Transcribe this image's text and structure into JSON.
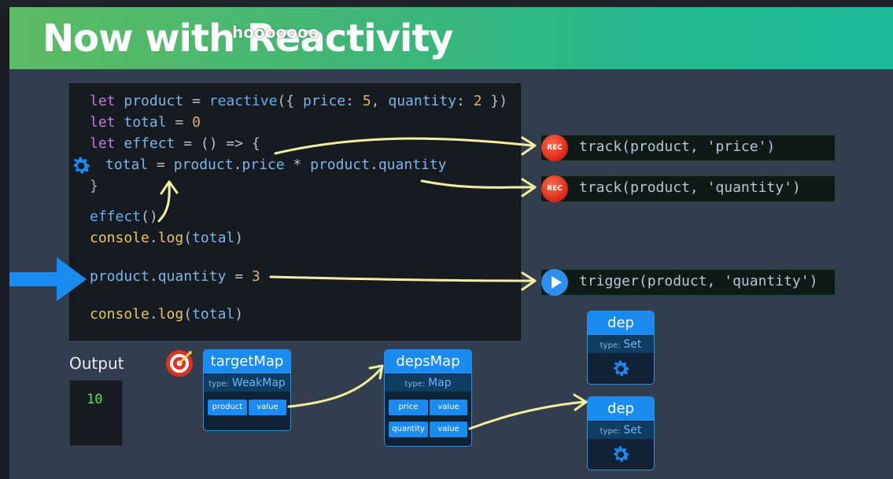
{
  "slide": {
    "title": "Now with Reactivity",
    "watermark": "hooooooo"
  },
  "code": {
    "l1": {
      "kw": "let",
      "name": "product",
      "eq": " = ",
      "fn": "reactive",
      "rest1": "({ ",
      "k1": "price",
      "c1": ": ",
      "v1": "5",
      "sep": ", ",
      "k2": "quantity",
      "c2": ": ",
      "v2": "2",
      "rest2": " })"
    },
    "l2": {
      "kw": "let",
      "name": "total",
      "eq": " = ",
      "v": "0"
    },
    "l3": {
      "kw": "let",
      "name": "effect",
      "rest": " = () => {"
    },
    "l4": {
      "a": "total",
      "eq": " = ",
      "b": "product",
      "dot1": ".",
      "c": "price",
      "mul": " * ",
      "d": "product",
      "dot2": ".",
      "e": "quantity"
    },
    "l5": {
      "text": "}"
    },
    "l6": {
      "fn": "effect",
      "rest": "()"
    },
    "l7": {
      "a": "console",
      "dot": ".",
      "b": "log",
      "c": "(",
      "d": "total",
      "e": ")"
    },
    "l8": {
      "a": "product",
      "dot": ".",
      "b": "quantity",
      "eq": " = ",
      "v": "3"
    },
    "l9": {
      "a": "console",
      "dot": ".",
      "b": "log",
      "c": "(",
      "d": "total",
      "e": ")"
    }
  },
  "callouts": [
    {
      "badge": "REC",
      "text": "track(product, 'price')"
    },
    {
      "badge": "REC",
      "text": "track(product, 'quantity')"
    },
    {
      "badge": "play",
      "text": "trigger(product, 'quantity')"
    }
  ],
  "output": {
    "label": "Output",
    "value": "10"
  },
  "targetMap": {
    "title": "targetMap",
    "type_label": "type:",
    "type": "WeakMap",
    "key": "product",
    "value": "value"
  },
  "depsMap": {
    "title": "depsMap",
    "type_label": "type:",
    "type": "Map",
    "rows": [
      {
        "key": "price",
        "value": "value"
      },
      {
        "key": "quantity",
        "value": "value"
      }
    ]
  },
  "dep1": {
    "title": "dep",
    "type_label": "type:",
    "type": "Set"
  },
  "dep2": {
    "title": "dep",
    "type_label": "type:",
    "type": "Set"
  },
  "colors": {
    "accent": "#1a8bf0",
    "header_start": "#5dbb63",
    "header_end": "#1cbb9b",
    "code_bg": "#161b22",
    "arrow": "#f3ef9c",
    "rec": "#e0321f",
    "output": "#5fdc5f"
  },
  "icons": {
    "settings": "gear-icon",
    "record": "record-icon",
    "play": "play-icon",
    "target": "target-icon",
    "pointer": "arrow-right-icon"
  }
}
